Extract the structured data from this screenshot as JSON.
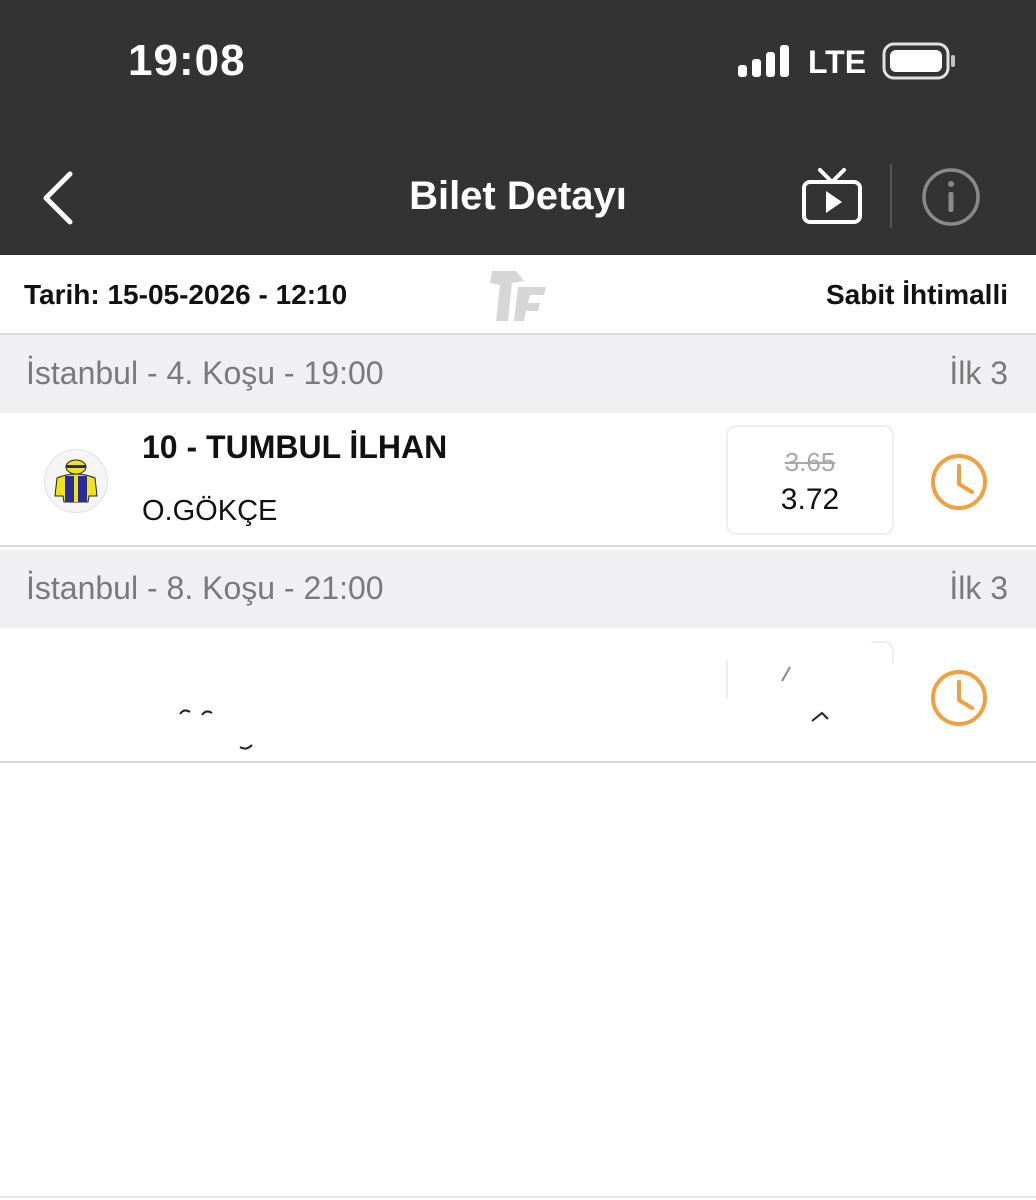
{
  "status_bar": {
    "time": "19:08",
    "network": "LTE"
  },
  "nav": {
    "title": "Bilet Detayı",
    "back_icon": "chevron-left-icon",
    "tv_icon": "tv-icon",
    "info_icon": "info-icon"
  },
  "ticket": {
    "date_label": "Tarih: 15-05-2026 - 12:10",
    "bet_type": "Sabit İhtimalli"
  },
  "races": [
    {
      "title": "İstanbul - 4. Koşu - 19:00",
      "type": "İlk 3",
      "horse": "10 - TUMBUL İLHAN",
      "jockey": "O.GÖKÇE",
      "odds_old": "3.65",
      "odds_new": "3.72",
      "status_icon": "clock-icon"
    },
    {
      "title": "İstanbul - 8. Koşu - 21:00",
      "type": "İlk 3",
      "horse": "",
      "jockey": "",
      "odds_old": "",
      "odds_new": "",
      "status_icon": "clock-icon"
    }
  ],
  "colors": {
    "header_bg": "#333333",
    "accent_orange": "#f0a040",
    "section_bg": "#f0f0f2",
    "muted_text": "#7a7a7a"
  }
}
